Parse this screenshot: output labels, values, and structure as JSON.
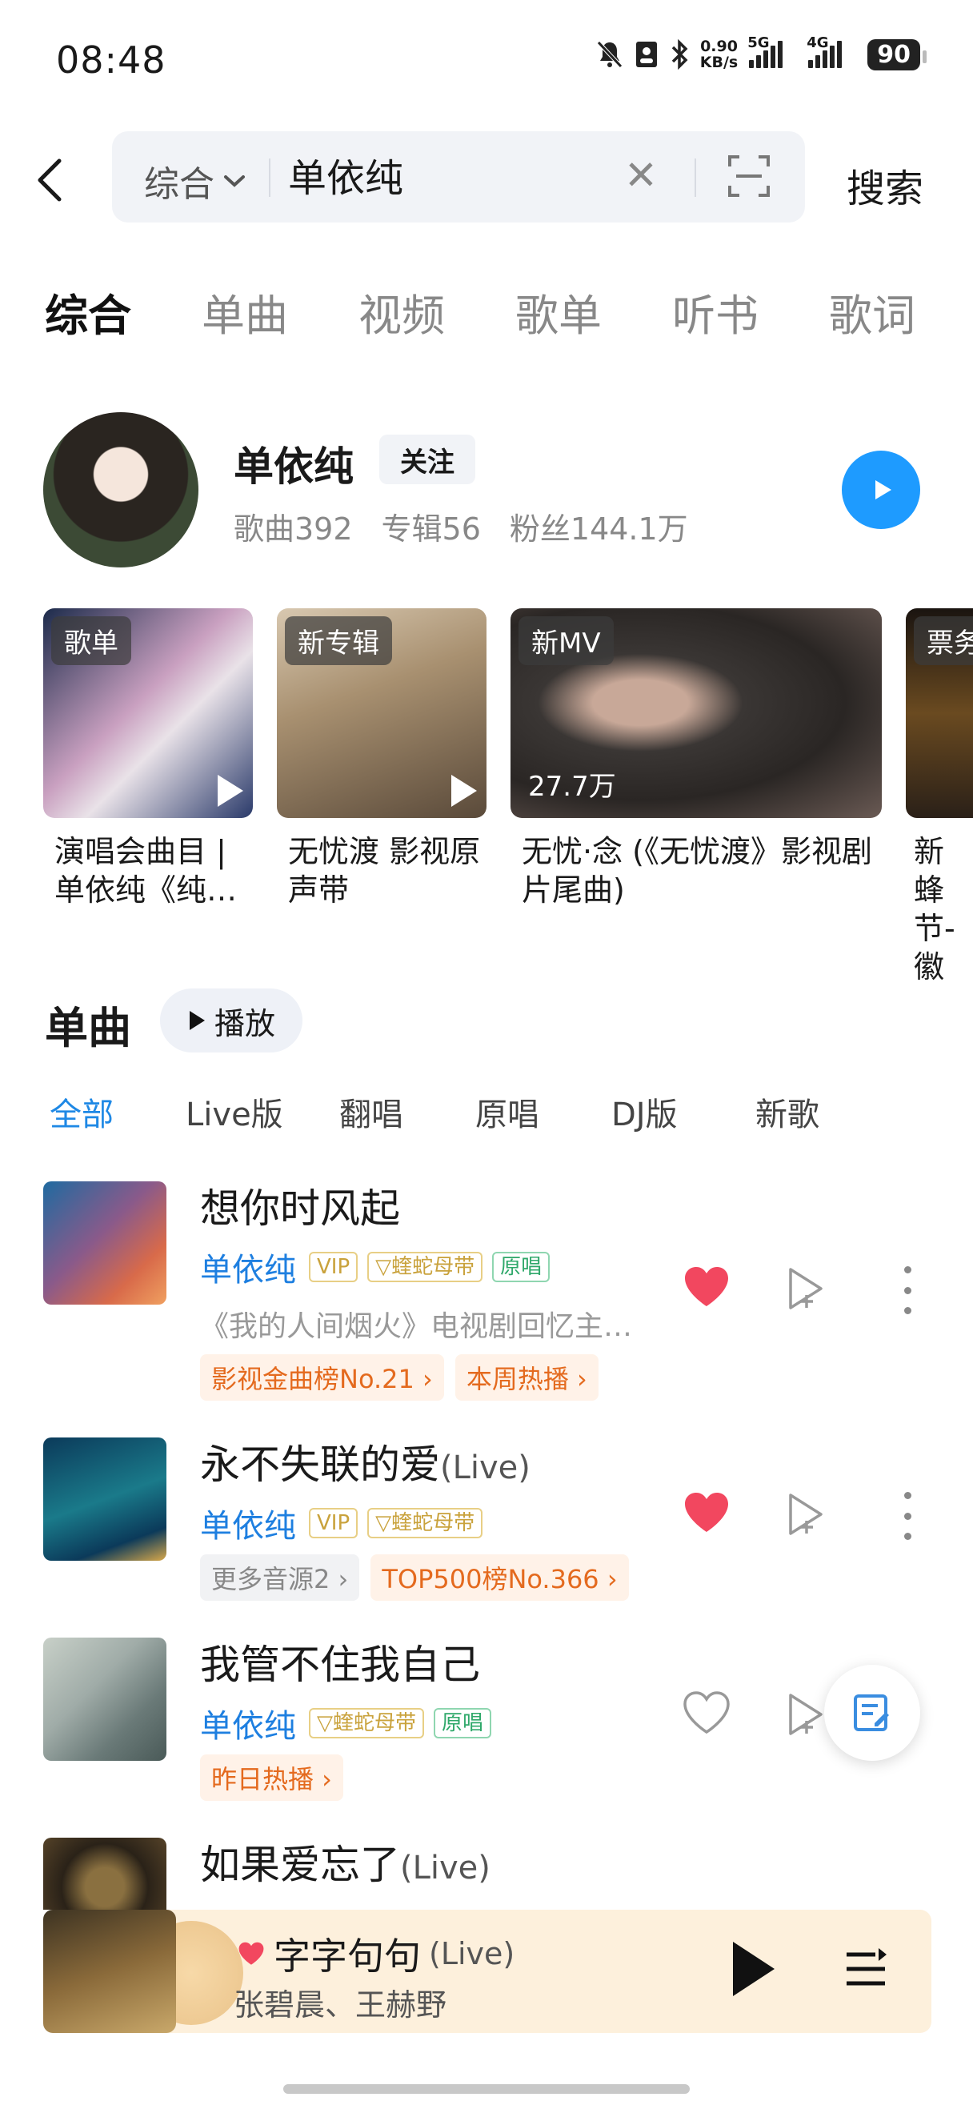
{
  "status_bar": {
    "time": "08:48",
    "net_speed_value": "0.90",
    "net_speed_unit": "KB/s",
    "sig1": "5G",
    "sig2": "4G",
    "battery": "90"
  },
  "search": {
    "scope": "综合",
    "query": "单依纯",
    "submit_label": "搜索"
  },
  "tabs": [
    {
      "label": "综合",
      "active": true
    },
    {
      "label": "单曲"
    },
    {
      "label": "视频"
    },
    {
      "label": "歌单"
    },
    {
      "label": "听书"
    },
    {
      "label": "歌词"
    }
  ],
  "artist": {
    "name": "单依纯",
    "follow_label": "关注",
    "songs": "歌曲392",
    "albums": "专辑56",
    "fans": "粉丝144.1万"
  },
  "cards": [
    {
      "badge": "歌单",
      "title": "演唱会曲目 | 单依纯《纯…",
      "colors": [
        "#1b2a4a",
        "#c9a0c0",
        "#e9e2e8"
      ]
    },
    {
      "badge": "新专辑",
      "title": "无忧渡 影视原声带",
      "colors": [
        "#5a4a3a",
        "#a89070",
        "#d8c8b0"
      ]
    },
    {
      "badge": "新MV",
      "title": "无忧·念 (《无忧渡》影视剧片尾曲)",
      "views": "27.7万",
      "colors": [
        "#2a2624",
        "#8a7a70",
        "#3a3634"
      ]
    },
    {
      "badge": "票务",
      "title": "新蜂节-徽",
      "colors": [
        "#1a1410",
        "#6a4a20",
        "#2a2018"
      ]
    }
  ],
  "singles": {
    "title": "单曲",
    "play_label": "播放",
    "filters": [
      {
        "label": "全部",
        "active": true
      },
      {
        "label": "Live版"
      },
      {
        "label": "翻唱"
      },
      {
        "label": "原唱"
      },
      {
        "label": "DJ版"
      },
      {
        "label": "新歌"
      }
    ],
    "songs": [
      {
        "title": "想你时风起",
        "suffix": "",
        "artist": "单依纯",
        "tags": [
          "VIP",
          "蝰蛇母带",
          "原唱"
        ],
        "desc": "《我的人间烟火》电视剧回忆主…",
        "chips": [
          "影视金曲榜No.21 ›",
          "本周热播 ›"
        ],
        "liked": true,
        "cover_colors": [
          "#1f6aa0",
          "#d86a4a",
          "#f0a060"
        ]
      },
      {
        "title": "永不失联的爱",
        "suffix": "(Live)",
        "artist": "单依纯",
        "tags": [
          "VIP",
          "蝰蛇母带"
        ],
        "chips_grey": "更多音源2 ›",
        "chips": [
          "TOP500榜No.366 ›"
        ],
        "liked": true,
        "cover_colors": [
          "#0b3a5a",
          "#1a7a8a",
          "#d8a84a"
        ]
      },
      {
        "title": "我管不住我自己",
        "suffix": "",
        "artist": "单依纯",
        "tags": [
          "蝰蛇母带",
          "原唱"
        ],
        "chips": [
          "昨日热播 ›"
        ],
        "liked": false,
        "cover_colors": [
          "#6a7a78",
          "#a0aca8",
          "#c8d0c8"
        ]
      },
      {
        "title": "如果爱忘了",
        "suffix": "(Live)",
        "artist": "",
        "tags": [],
        "chips": [],
        "liked": true,
        "cover_colors": [
          "#2a2218",
          "#6a5230",
          "#8a7040"
        ]
      }
    ]
  },
  "player": {
    "title": "字字句句",
    "suffix": "(Live)",
    "artists": "张碧晨、王赫野"
  },
  "colors": {
    "accent": "#1e88e5",
    "heart": "#f2475f",
    "chip_orange": "#e46a1e"
  }
}
